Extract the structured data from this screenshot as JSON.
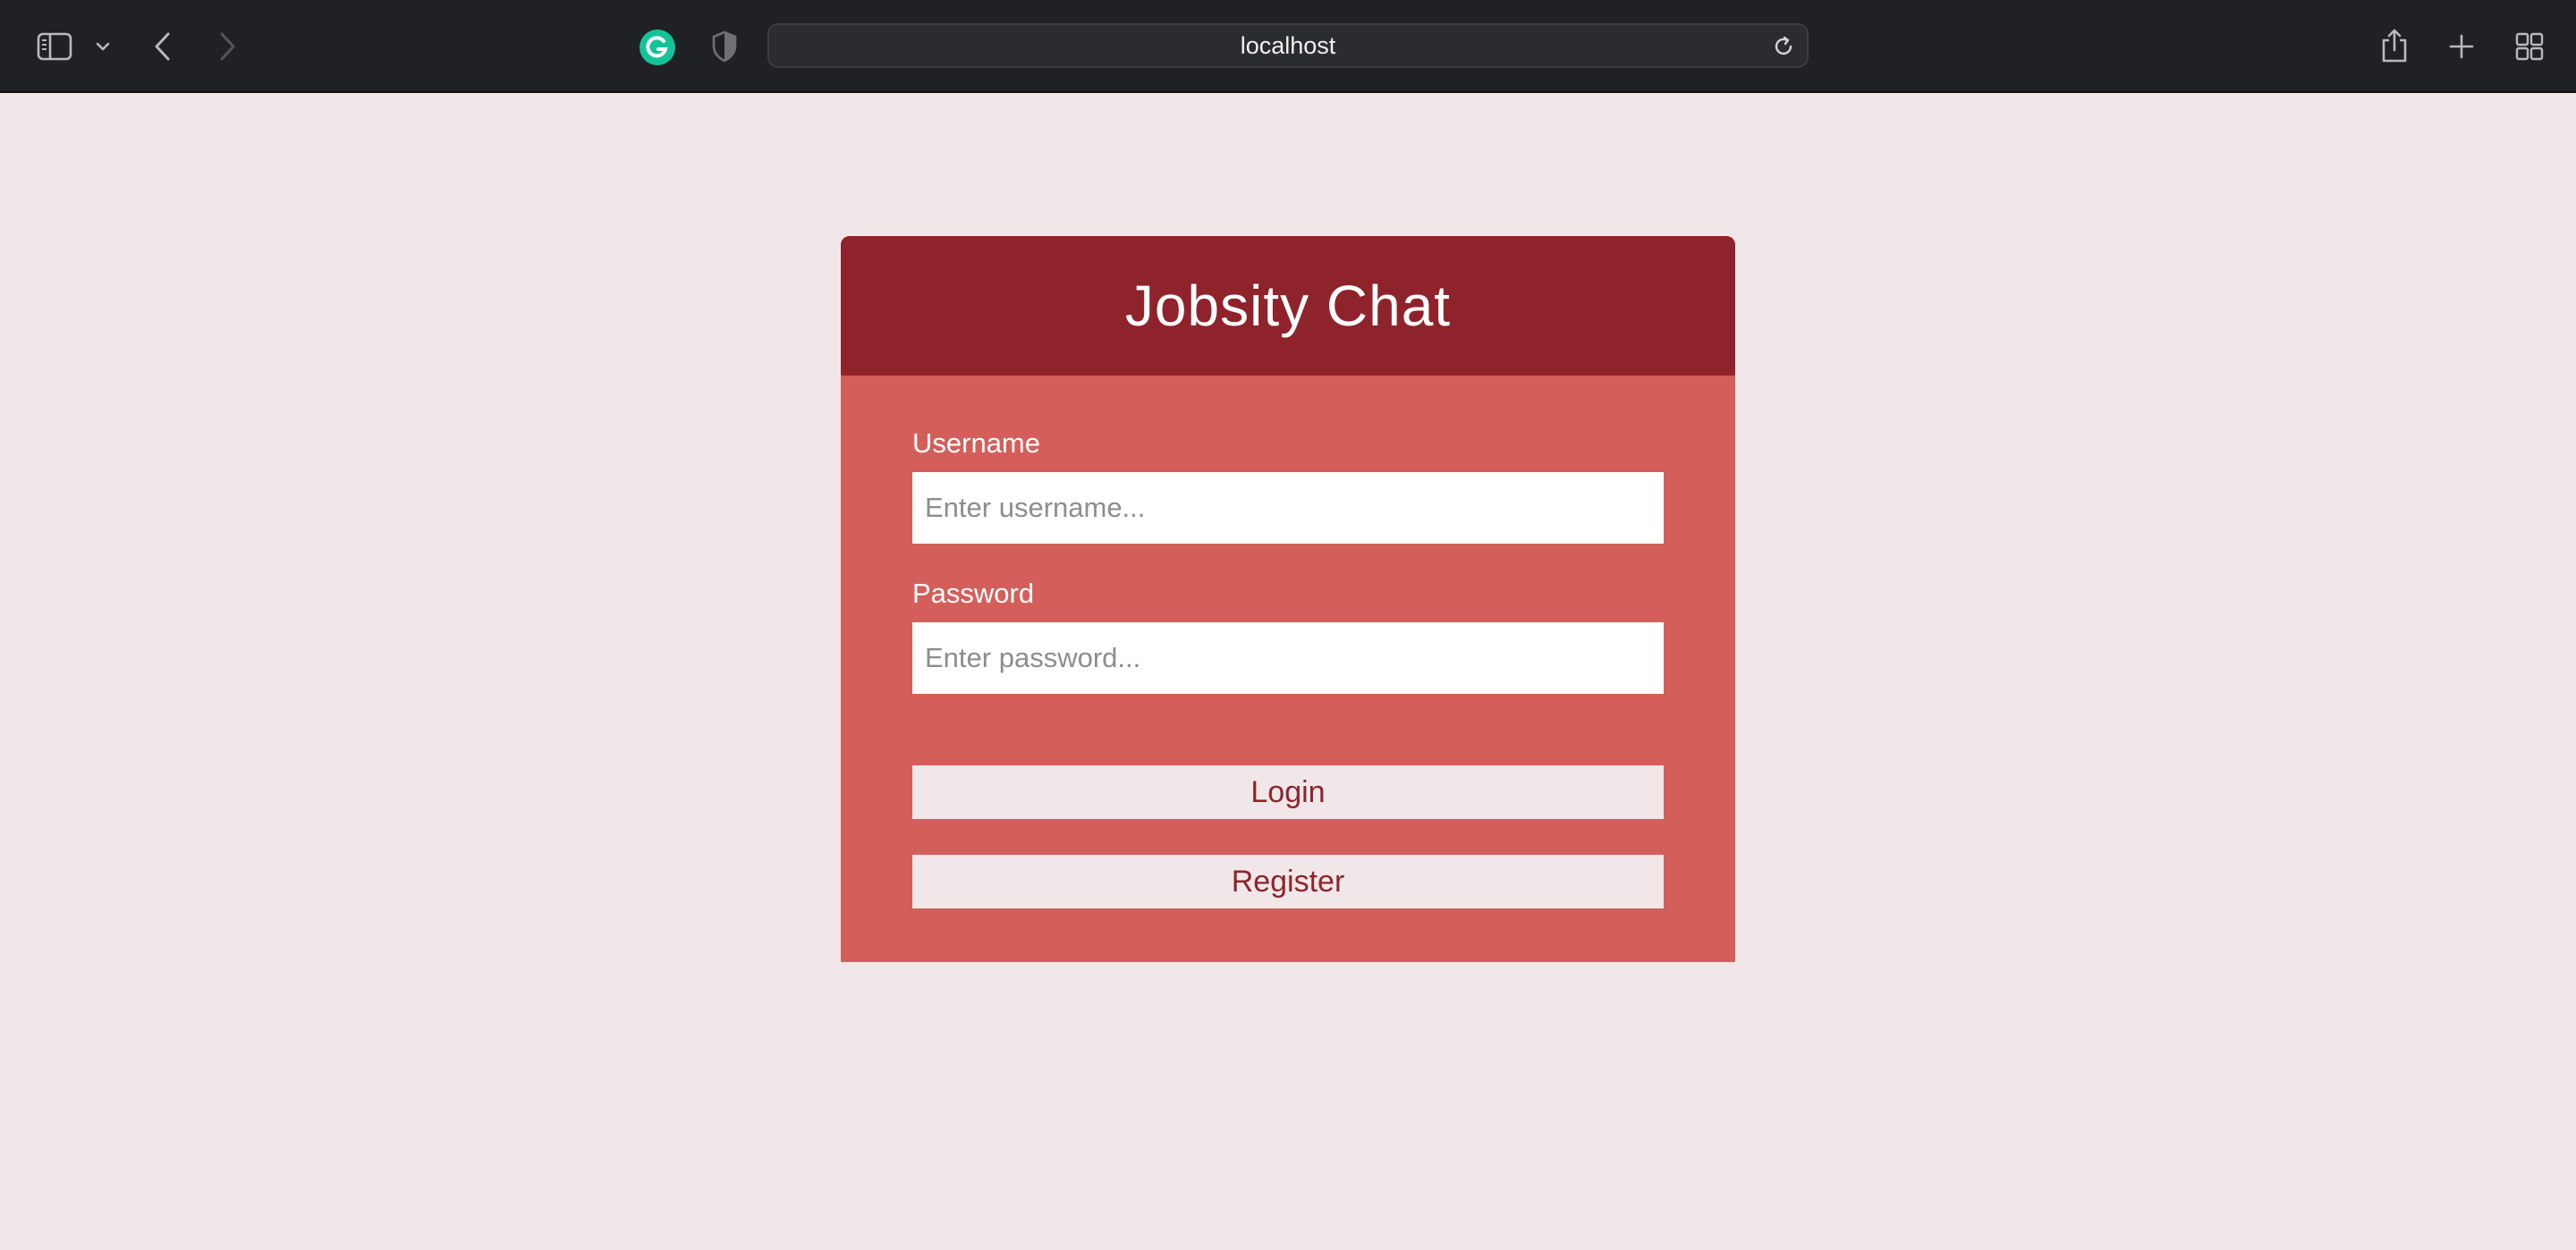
{
  "browser": {
    "address": "localhost",
    "icons": {
      "sidebar": "sidebar-icon",
      "chevron": "chevron-down-icon",
      "back": "back-arrow-icon",
      "forward": "forward-arrow-icon",
      "extension": "grammarly-icon",
      "privacy": "shield-icon",
      "reload": "reload-icon",
      "share": "share-icon",
      "new_tab": "plus-icon",
      "tab_overview": "grid-icon"
    },
    "colors": {
      "toolbar_bg": "#202124",
      "grammarly": "#15c39a"
    }
  },
  "login": {
    "title": "Jobsity Chat",
    "username_label": "Username",
    "username_placeholder": "Enter username...",
    "username_value": "",
    "password_label": "Password",
    "password_placeholder": "Enter password...",
    "password_value": "",
    "login_label": "Login",
    "register_label": "Register"
  },
  "colors": {
    "page_bg": "#f1e7e8",
    "header_bg": "#8f232b",
    "card_bg": "#d45f5a",
    "button_bg": "#f1e7e8",
    "button_text": "#8f232b"
  }
}
